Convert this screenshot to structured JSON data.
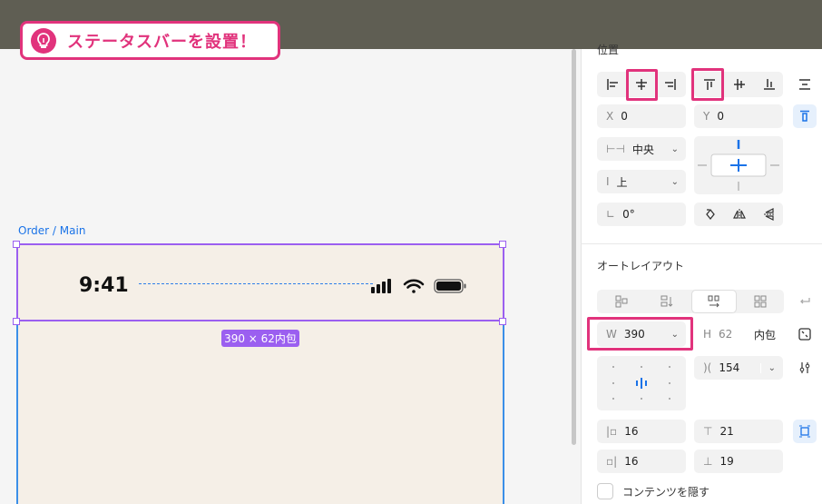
{
  "banner": {
    "text": "ステータスバーを設置！"
  },
  "canvas": {
    "frame_label": "Order / Main",
    "status_time": "9:41",
    "dimension_tag": "390 × 62内包"
  },
  "position": {
    "title": "位置",
    "x_label": "X",
    "x_value": "0",
    "y_label": "Y",
    "y_value": "0",
    "h_constraint": "中央",
    "v_constraint": "上",
    "rotation": "0°"
  },
  "autolayout": {
    "title": "オートレイアウト",
    "w_label": "W",
    "w_value": "390",
    "h_label": "H",
    "h_value": "62",
    "h_mode": "内包",
    "gap_value": "154",
    "pad_left": "16",
    "pad_top": "21",
    "pad_right": "16",
    "pad_bottom": "19",
    "clip_label": "コンテンツを隠す"
  },
  "colors": {
    "accent": "#e1337c",
    "selection": "#9b5ff0",
    "frame": "#3b8fe8",
    "blue": "#1a73e8"
  }
}
